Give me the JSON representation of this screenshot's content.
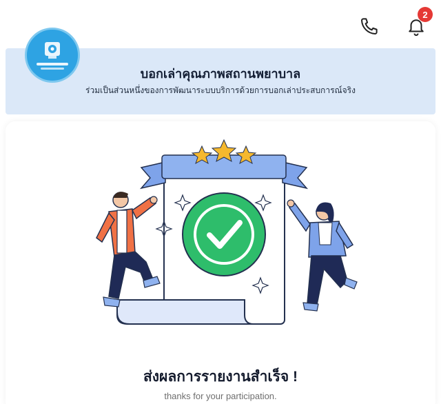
{
  "topbar": {
    "phone_icon": "phone-icon",
    "bell_icon": "bell-icon",
    "notification_count": "2",
    "badge_color": "#e53935"
  },
  "banner": {
    "title": "บอกเล่าคุณภาพสถานพยาบาล",
    "subtitle": "ร่วมเป็นส่วนหนึ่งของการพัฒนาระบบบริการด้วยการบอกเล่าประสบการณ์จริง",
    "background": "#dbe8f8",
    "logo_color": "#2ea3e3"
  },
  "success": {
    "illustration": "success-illustration",
    "title": "ส่งผลการรายงานสำเร็จ !",
    "subtitle": "thanks for your participation.",
    "check_color": "#2ebd6b"
  }
}
